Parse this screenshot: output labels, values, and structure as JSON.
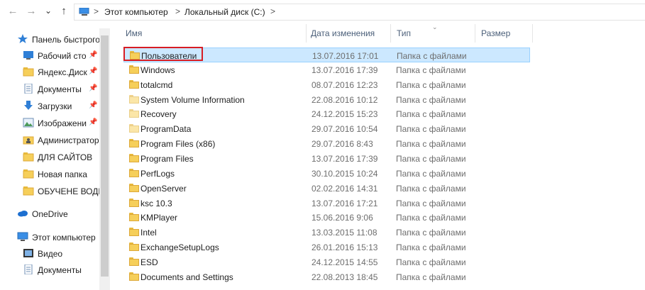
{
  "address": {
    "crumbs": [
      "Этот компьютер",
      "Локальный диск (C:)"
    ],
    "separators": [
      ">",
      ">",
      ">"
    ]
  },
  "navigation": {
    "back_glyph": "←",
    "forward_glyph": "→",
    "recent_glyph": "⌄",
    "up_glyph": "↑"
  },
  "sidebar": {
    "items": [
      {
        "label": "Панель быстрого",
        "icon": "star-icon",
        "pinned": false
      },
      {
        "label": "Рабочий сто",
        "icon": "desktop-icon",
        "pinned": true
      },
      {
        "label": "Яндекс.Диск",
        "icon": "folder-icon",
        "pinned": true
      },
      {
        "label": "Документы",
        "icon": "documents-icon",
        "pinned": true
      },
      {
        "label": "Загрузки",
        "icon": "download-icon",
        "pinned": true
      },
      {
        "label": "Изображени",
        "icon": "pictures-icon",
        "pinned": true
      },
      {
        "label": "Администратор",
        "icon": "user-folder-icon",
        "pinned": false
      },
      {
        "label": "ДЛЯ САЙТОВ",
        "icon": "folder-icon",
        "pinned": false
      },
      {
        "label": "Новая папка",
        "icon": "folder-icon",
        "pinned": false
      },
      {
        "label": "ОБУЧЕНЕ ВОДИ",
        "icon": "folder-icon",
        "pinned": false
      },
      {
        "label": "OneDrive",
        "icon": "cloud-icon",
        "pinned": false
      },
      {
        "label": "Этот компьютер",
        "icon": "computer-icon",
        "pinned": false
      },
      {
        "label": "Видео",
        "icon": "video-icon",
        "pinned": false
      },
      {
        "label": "Документы",
        "icon": "documents-icon",
        "pinned": false
      }
    ],
    "pin_glyph": "📌"
  },
  "columns": {
    "name": "Имя",
    "date": "Дата изменения",
    "type": "Тип",
    "size": "Размер",
    "sort_glyph": "⌄"
  },
  "files": [
    {
      "name": "Пользователи",
      "date": "13.07.2016 17:01",
      "type": "Папка с файлами",
      "selected": true,
      "light": false
    },
    {
      "name": "Windows",
      "date": "13.07.2016 17:39",
      "type": "Папка с файлами",
      "selected": false,
      "light": false
    },
    {
      "name": "totalcmd",
      "date": "08.07.2016 12:23",
      "type": "Папка с файлами",
      "selected": false,
      "light": false
    },
    {
      "name": "System Volume Information",
      "date": "22.08.2016 10:12",
      "type": "Папка с файлами",
      "selected": false,
      "light": true
    },
    {
      "name": "Recovery",
      "date": "24.12.2015 15:23",
      "type": "Папка с файлами",
      "selected": false,
      "light": true
    },
    {
      "name": "ProgramData",
      "date": "29.07.2016 10:54",
      "type": "Папка с файлами",
      "selected": false,
      "light": true
    },
    {
      "name": "Program Files (x86)",
      "date": "29.07.2016 8:43",
      "type": "Папка с файлами",
      "selected": false,
      "light": false
    },
    {
      "name": "Program Files",
      "date": "13.07.2016 17:39",
      "type": "Папка с файлами",
      "selected": false,
      "light": false
    },
    {
      "name": "PerfLogs",
      "date": "30.10.2015 10:24",
      "type": "Папка с файлами",
      "selected": false,
      "light": false
    },
    {
      "name": "OpenServer",
      "date": "02.02.2016 14:31",
      "type": "Папка с файлами",
      "selected": false,
      "light": false
    },
    {
      "name": "ksc 10.3",
      "date": "13.07.2016 17:21",
      "type": "Папка с файлами",
      "selected": false,
      "light": false
    },
    {
      "name": "KMPlayer",
      "date": "15.06.2016 9:06",
      "type": "Папка с файлами",
      "selected": false,
      "light": false
    },
    {
      "name": "Intel",
      "date": "13.03.2015 11:08",
      "type": "Папка с файлами",
      "selected": false,
      "light": false
    },
    {
      "name": "ExchangeSetupLogs",
      "date": "26.01.2016 15:13",
      "type": "Папка с файлами",
      "selected": false,
      "light": false
    },
    {
      "name": "ESD",
      "date": "24.12.2015 14:55",
      "type": "Папка с файлами",
      "selected": false,
      "light": false
    },
    {
      "name": "Documents and Settings",
      "date": "22.08.2013 18:45",
      "type": "Папка с файлами",
      "selected": false,
      "light": false
    }
  ],
  "colors": {
    "selection": "#cce8ff",
    "selection_border": "#99d1ff",
    "highlight_box": "#d71d24",
    "folder": "#f6cf5a"
  }
}
